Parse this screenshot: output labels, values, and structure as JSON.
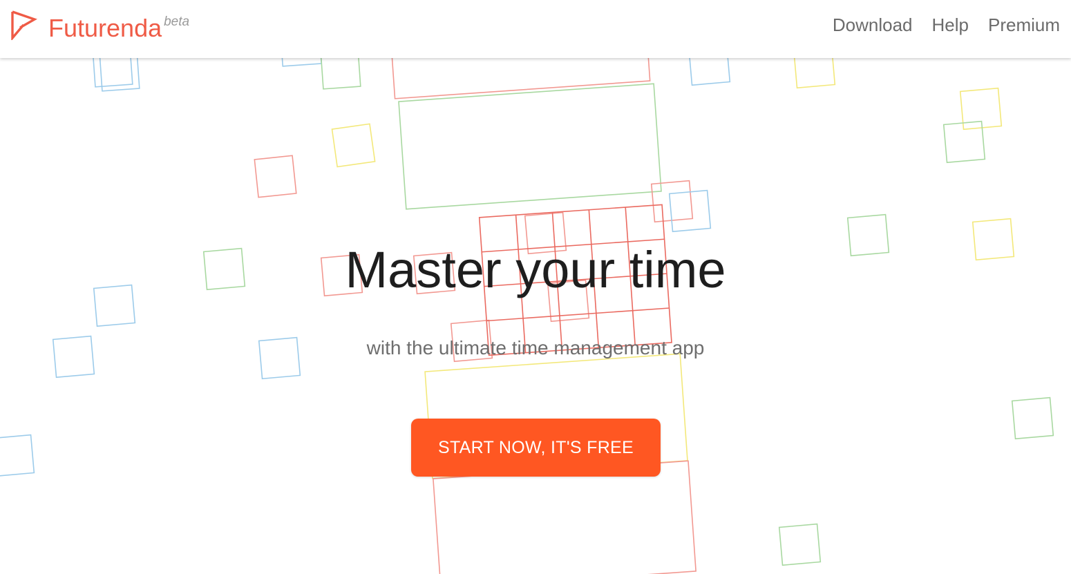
{
  "brand": {
    "name": "Futurenda",
    "badge": "beta",
    "color": "#ef5b46"
  },
  "nav": {
    "links": [
      {
        "label": "Download"
      },
      {
        "label": "Help"
      },
      {
        "label": "Premium"
      }
    ]
  },
  "hero": {
    "title": "Master your time",
    "subtitle": "with the ultimate time management app",
    "cta_label": "START NOW, IT'S FREE",
    "cta_color": "#ff5722"
  },
  "background": {
    "shape_colors": [
      "#f29891",
      "#a8d8a0",
      "#9ccbea",
      "#f3e87a"
    ]
  },
  "icons": {
    "logo": "futurenda-flag-icon"
  }
}
